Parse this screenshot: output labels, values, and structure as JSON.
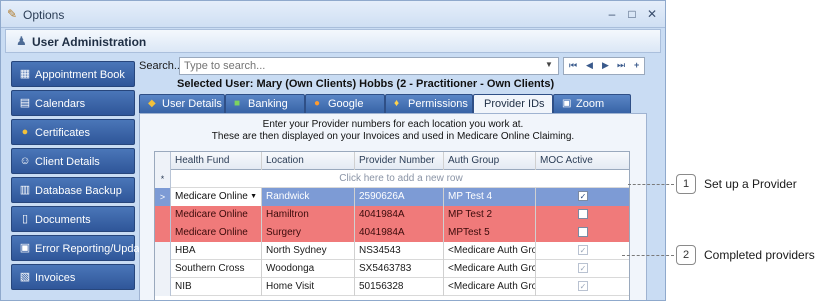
{
  "window": {
    "title": "Options",
    "controls": [
      "–",
      "□",
      "✕"
    ]
  },
  "section": {
    "title": "User Administration"
  },
  "nav": [
    {
      "label": "Appointment Book",
      "icon": "▦"
    },
    {
      "label": "Calendars",
      "icon": "▤"
    },
    {
      "label": "Certificates",
      "icon": "●"
    },
    {
      "label": "Client Details",
      "icon": "☺"
    },
    {
      "label": "Database Backup",
      "icon": "▥"
    },
    {
      "label": "Documents",
      "icon": "▯"
    },
    {
      "label": "Error Reporting/Updates",
      "icon": "▣"
    },
    {
      "label": "Invoices",
      "icon": "▧"
    }
  ],
  "search": {
    "label": "Search...",
    "placeholder": "Type to search...",
    "pager": [
      "⏮",
      "◀",
      "▶",
      "⏭",
      "+"
    ]
  },
  "selected_user": "Selected User: Mary (Own Clients) Hobbs (2 - Practitioner - Own Clients)",
  "tabs": [
    {
      "label": "User Details",
      "icon": "◆"
    },
    {
      "label": "Banking",
      "icon": "■"
    },
    {
      "label": "Google",
      "icon": "●"
    },
    {
      "label": "Permissions",
      "icon": "♦"
    },
    {
      "label": "Provider IDs",
      "icon": ""
    },
    {
      "label": "Zoom",
      "icon": "▣"
    }
  ],
  "instructions": {
    "line1": "Enter your Provider numbers for each location you work at.",
    "line2": "These are then displayed on your Invoices and used in Medicare Online Claiming."
  },
  "grid": {
    "columns": [
      "Health Fund",
      "Location",
      "Provider Number",
      "Auth Group",
      "MOC Active"
    ],
    "add_row_marker": "*",
    "add_row_text": "Click here to add a new row",
    "rows": [
      {
        "indicator": ">",
        "health_fund": "Medicare Online",
        "location": "Randwick",
        "provider_number": "2590626A",
        "auth_group": "MP Test 4",
        "moc_active": true,
        "style": "selected"
      },
      {
        "indicator": "",
        "health_fund": "Medicare Online",
        "location": "Hamiltron",
        "provider_number": "4041984A",
        "auth_group": "MP Test 2",
        "moc_active": false,
        "style": "error"
      },
      {
        "indicator": "",
        "health_fund": "Medicare Online",
        "location": "Surgery",
        "provider_number": "4041984A",
        "auth_group": "MPTest 5",
        "moc_active": false,
        "style": "error"
      },
      {
        "indicator": "",
        "health_fund": "HBA",
        "location": "North Sydney",
        "provider_number": "NS34543",
        "auth_group": "<Medicare Auth Gro...",
        "moc_active": true,
        "style": "normal"
      },
      {
        "indicator": "",
        "health_fund": "Southern Cross",
        "location": "Woodonga",
        "provider_number": "SX5463783",
        "auth_group": "<Medicare Auth Gro...",
        "moc_active": true,
        "style": "normal"
      },
      {
        "indicator": "",
        "health_fund": "NIB",
        "location": "Home Visit",
        "provider_number": "50156328",
        "auth_group": "<Medicare Auth Gro...",
        "moc_active": true,
        "style": "normal"
      }
    ]
  },
  "callouts": [
    {
      "number": "1",
      "text": "Set up a Provider"
    },
    {
      "number": "2",
      "text": "Completed providers"
    }
  ]
}
